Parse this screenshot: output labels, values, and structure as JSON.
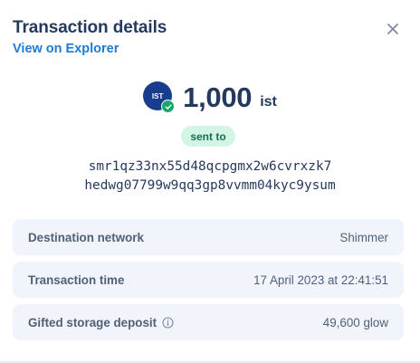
{
  "header": {
    "title": "Transaction details",
    "explorer_link": "View on Explorer"
  },
  "icons": {
    "close": "close-icon",
    "token_check": "check-badge-icon",
    "info": "info-icon"
  },
  "colors": {
    "title": "#25395f",
    "link": "#1e7bd6",
    "token_bg": "#1a3c8e",
    "check_green": "#15a86b",
    "pill_bg": "#d3f5e5",
    "pill_text": "#1b6e4c",
    "row_bg": "#f1f5fb"
  },
  "transaction": {
    "token_symbol": "IST",
    "amount": "1,000",
    "unit": "ist",
    "direction_label": "sent to",
    "address_line1": "smr1qz33nx55d48qcpgmx2w6cvrxzk7",
    "address_line2": "hedwg07799w9qq3gp8vvmm04kyc9ysum"
  },
  "details": [
    {
      "label": "Destination network",
      "value": "Shimmer"
    },
    {
      "label": "Transaction time",
      "value": "17 April 2023 at 22:41:51"
    },
    {
      "label": "Gifted storage deposit",
      "value": "49,600 glow"
    }
  ]
}
